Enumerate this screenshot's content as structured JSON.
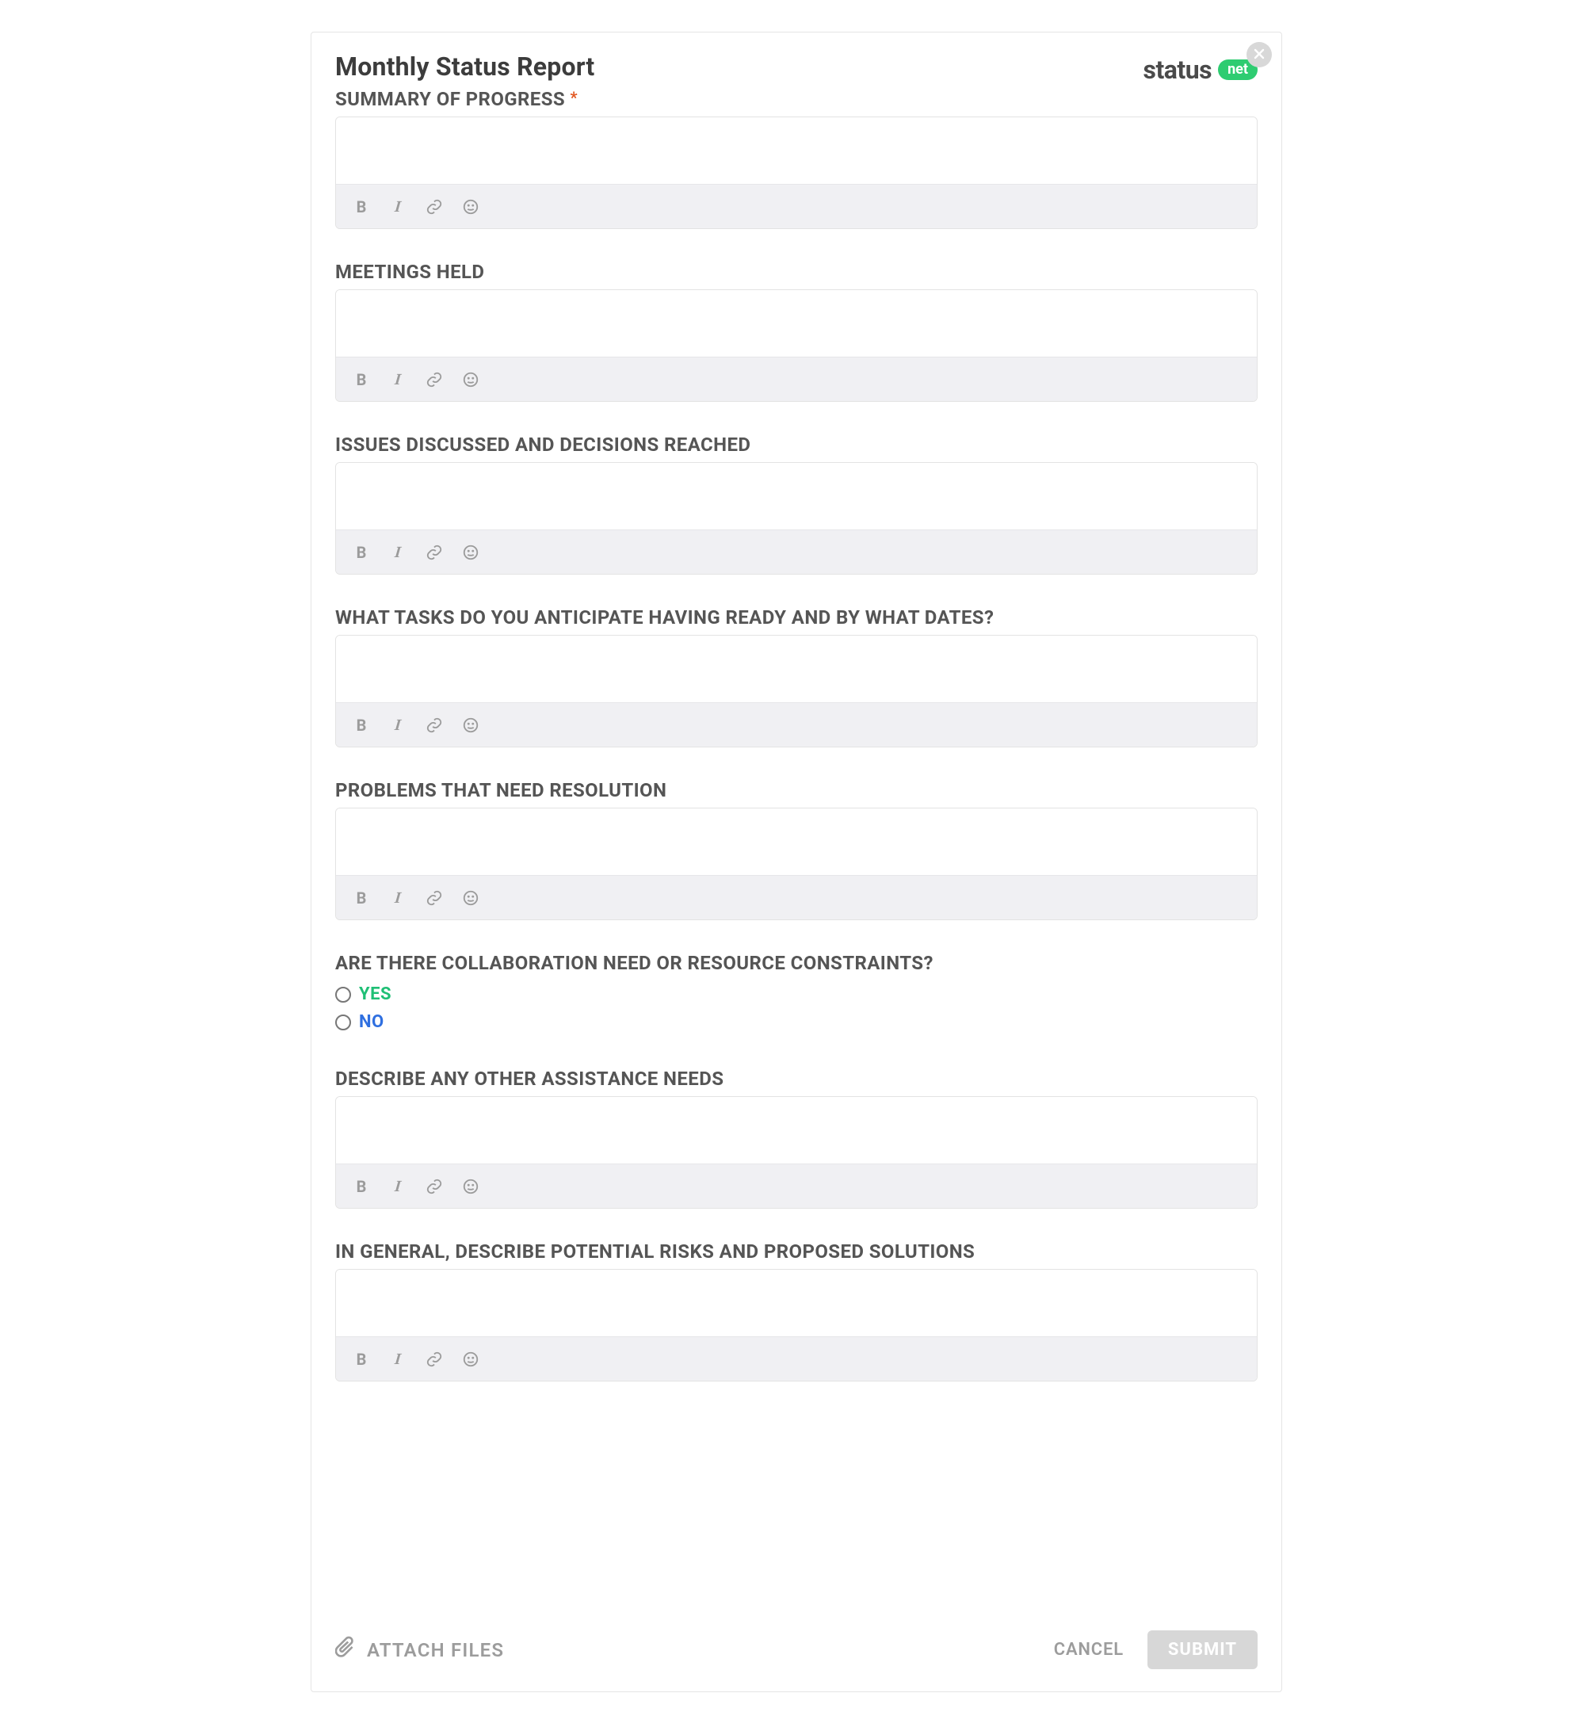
{
  "title": "Monthly Status Report",
  "brand": {
    "word": "status",
    "pill": "net"
  },
  "required_marker": "*",
  "sections": {
    "summary": {
      "label": "SUMMARY OF PROGRESS",
      "required": true,
      "value": ""
    },
    "meetings": {
      "label": "MEETINGS HELD",
      "value": ""
    },
    "issues": {
      "label": "ISSUES DISCUSSED AND DECISIONS REACHED",
      "value": ""
    },
    "tasks": {
      "label": "WHAT TASKS DO YOU ANTICIPATE HAVING READY AND BY WHAT DATES?",
      "value": ""
    },
    "problems": {
      "label": "PROBLEMS THAT NEED RESOLUTION",
      "value": ""
    },
    "collab": {
      "label": "ARE THERE COLLABORATION NEED OR RESOURCE CONSTRAINTS?",
      "options": {
        "yes": "YES",
        "no": "NO"
      }
    },
    "assist": {
      "label": "DESCRIBE ANY OTHER ASSISTANCE NEEDS",
      "value": ""
    },
    "risks": {
      "label": "IN GENERAL, DESCRIBE POTENTIAL RISKS AND PROPOSED SOLUTIONS",
      "value": ""
    }
  },
  "toolbar": {
    "bold": "B",
    "italic": "I"
  },
  "footer": {
    "attach": "ATTACH FILES",
    "cancel": "CANCEL",
    "submit": "SUBMIT"
  }
}
